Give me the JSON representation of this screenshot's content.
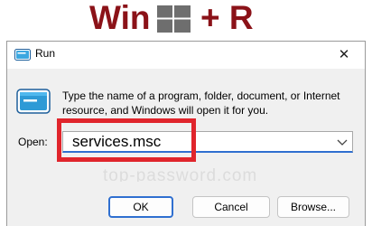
{
  "banner": {
    "win_text": "Win",
    "plus_text": "+ R",
    "logo_icon": "windows-logo-icon",
    "color": "#8b1218"
  },
  "dialog": {
    "title": "Run",
    "title_icon": "run-icon",
    "close_symbol": "✕",
    "description": "Type the name of a program, folder, document, or Internet resource, and Windows will open it for you.",
    "open_label": "Open:",
    "command_value": "services.msc",
    "watermark": "top-password.com",
    "buttons": {
      "ok": "OK",
      "cancel": "Cancel",
      "browse": "Browse..."
    }
  },
  "colors": {
    "accent": "#2f6fd0",
    "highlight": "#e0252c"
  }
}
